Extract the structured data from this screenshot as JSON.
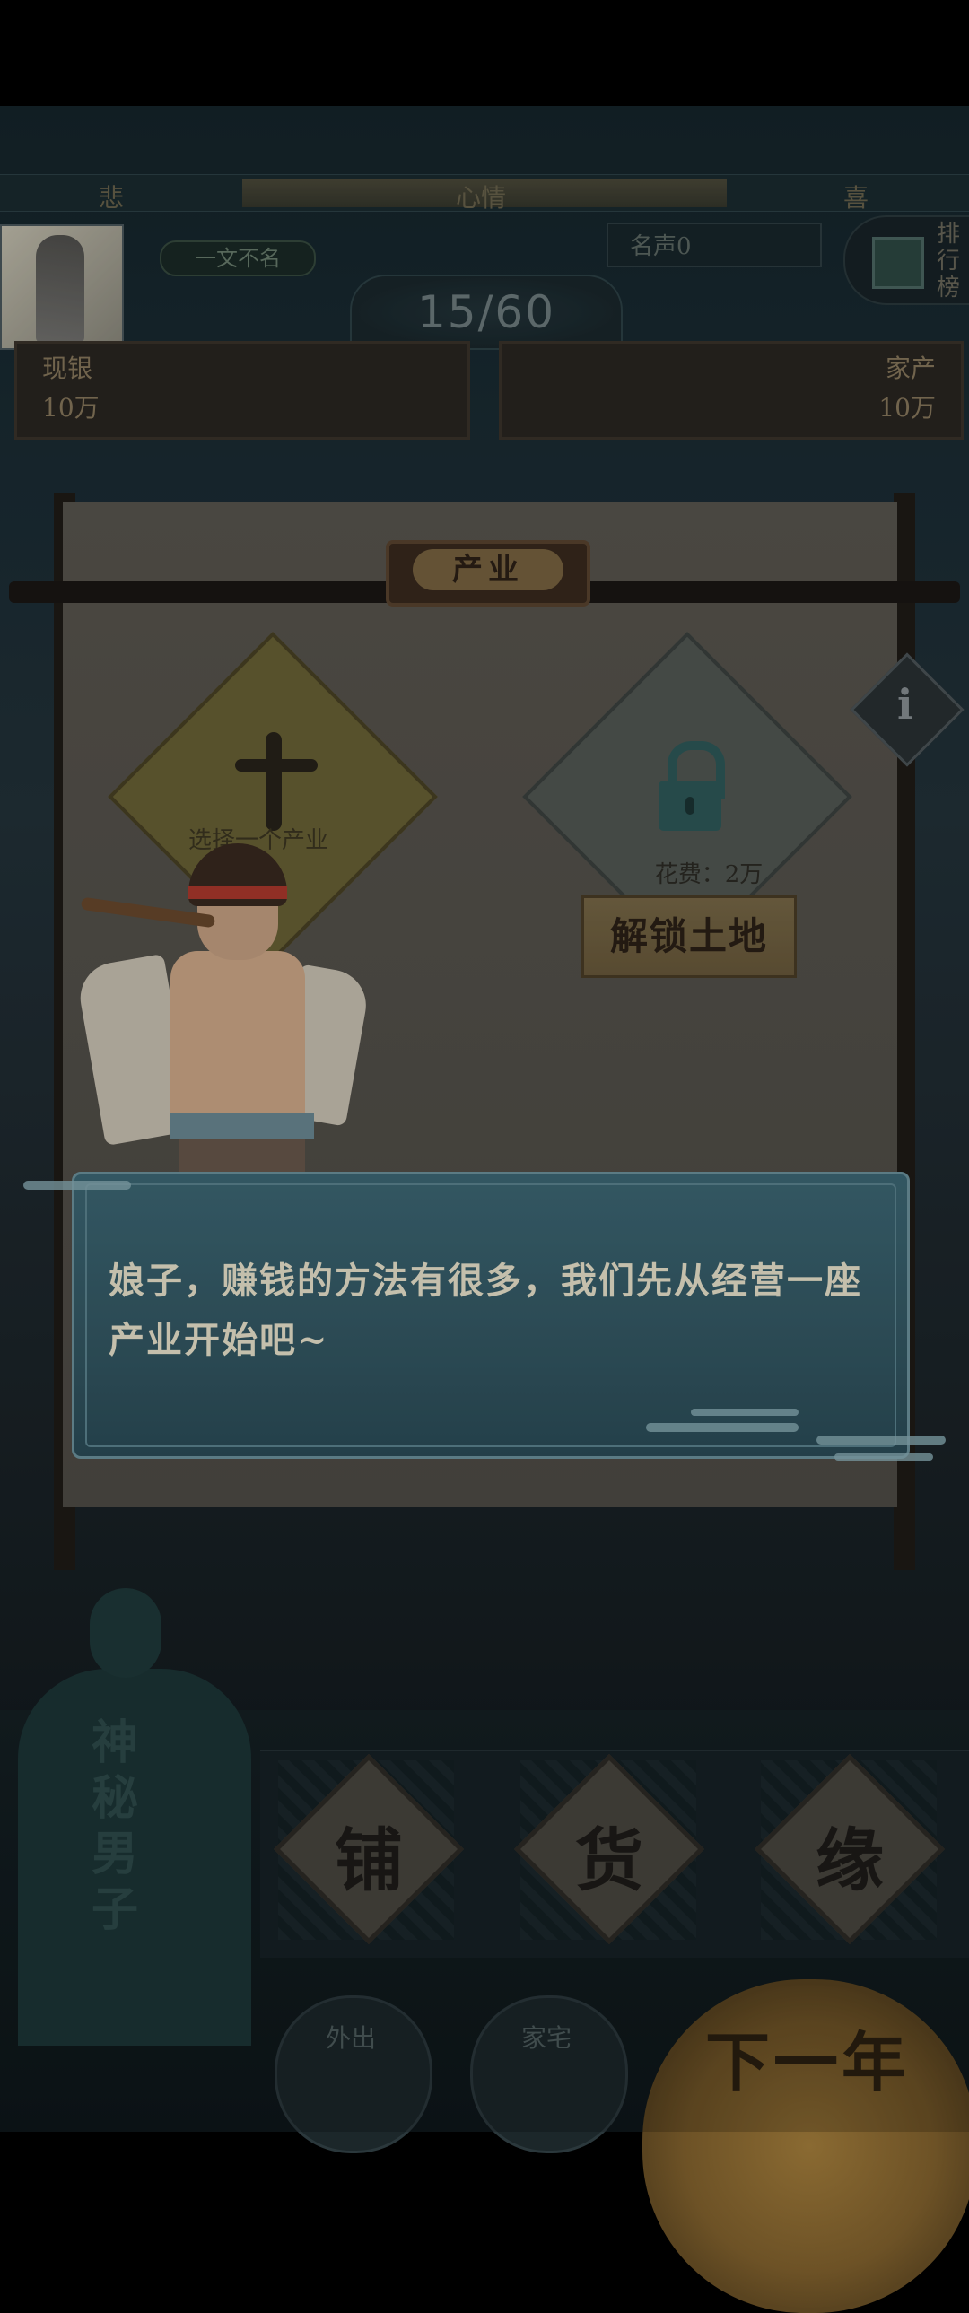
{
  "mood": {
    "left": "悲",
    "center": "心情",
    "right": "喜"
  },
  "player": {
    "title": "一文不名",
    "fame": "名声0",
    "turn": "15/60"
  },
  "rank": {
    "label": "排行榜"
  },
  "money": {
    "cash_label": "现银",
    "cash_value": "10万",
    "assets_label": "家产",
    "assets_value": "10万"
  },
  "board": {
    "title": "产业",
    "add_slot_text": "选择一个产业",
    "cost_text": "花费：2万",
    "unlock_button": "解锁土地",
    "info_icon": "i"
  },
  "dialog": {
    "text": "娘子，赚钱的方法有很多，我们先从经营一座产业开始吧~"
  },
  "bottom": {
    "mystery_label": "神秘男子",
    "shops": [
      "铺",
      "货",
      "缘"
    ],
    "outing_label": "外出",
    "home_label": "家宅",
    "next_year_label": "下一年"
  },
  "colors": {
    "dialog_bg": "#3e6a78",
    "board_bg": "#5a5750",
    "accent_gold": "#7a6a48"
  }
}
